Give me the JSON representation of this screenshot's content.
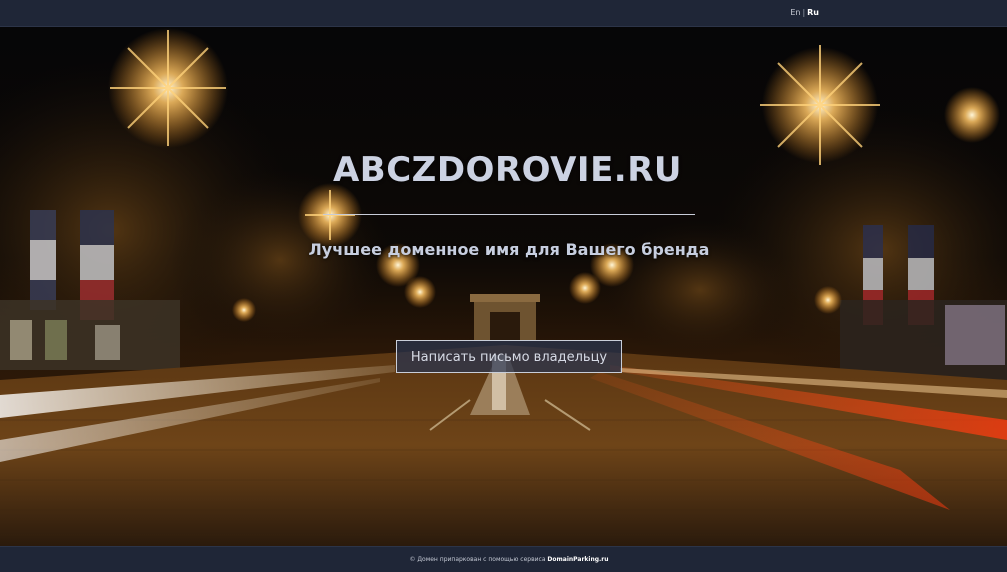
{
  "topbar": {
    "lang_en": "En",
    "lang_sep": "|",
    "lang_ru": "Ru"
  },
  "hero": {
    "domain": "ABCZDOROVIE.RU",
    "tagline": "Лучшее доменное имя для Вашего бренда",
    "contact_button": "Написать письмо владельцу"
  },
  "footer": {
    "text": "© Домен припаркован с помощью сервиса",
    "brand": "DomainParking.ru"
  },
  "colors": {
    "bar_bg": "#1f2637",
    "title": "#ccd2e2",
    "button_bg": "#2a3450",
    "street_light": "#ffb347"
  },
  "background": {
    "image_subject": "night-avenue-city-lights"
  }
}
